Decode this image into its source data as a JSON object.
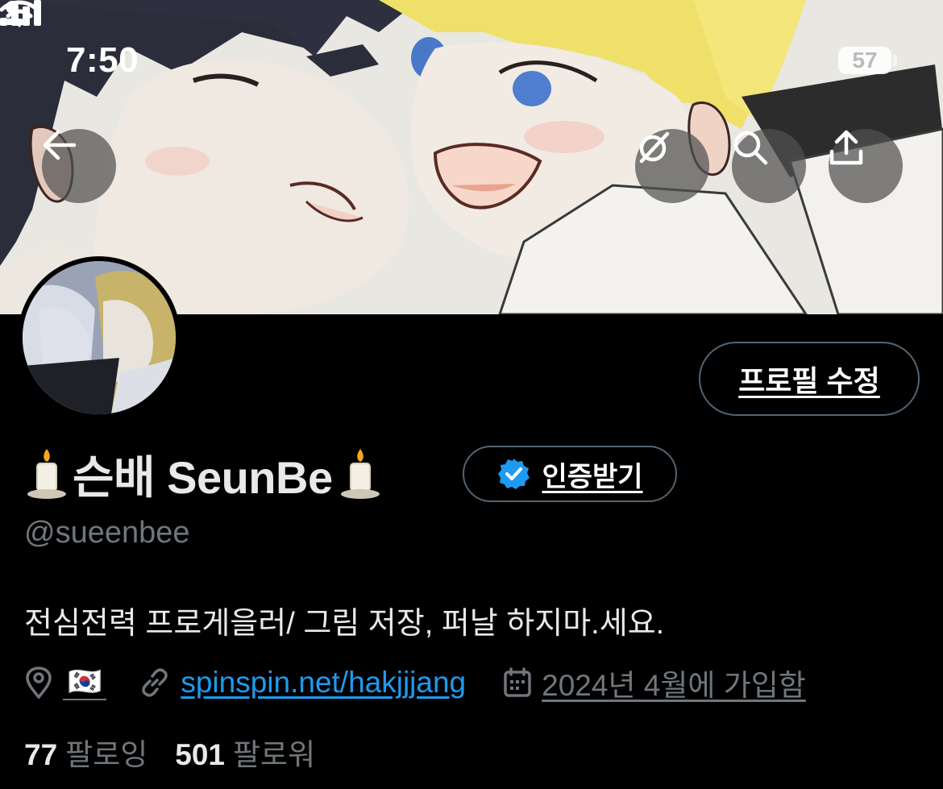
{
  "status_bar": {
    "time": "7:50",
    "battery": "57"
  },
  "profile": {
    "display_name": "슨배 SeunBe",
    "handle": "@sueenbee",
    "bio": "전심전력 프로게을러/ 그림 저장, 퍼날 하지마.세요.",
    "location_flag": "🇰🇷",
    "website": "spinspin.net/hakjjjang",
    "joined": "2024년 4월에 가입함",
    "edit_label": "프로필 수정",
    "verify_label": "인증받기"
  },
  "stats": {
    "following_count": "77",
    "following_label": "팔로잉",
    "followers_count": "501",
    "followers_label": "팔로워"
  },
  "icons": {
    "back": "arrow-left-icon",
    "grok": "grok-icon",
    "search": "search-icon",
    "share": "share-icon",
    "location": "location-pin-icon",
    "link": "link-icon",
    "calendar": "calendar-icon",
    "verified": "verified-badge-icon",
    "candle": "candle-icon"
  },
  "colors": {
    "accent": "#1d9bf0",
    "muted": "#71767b",
    "border": "#536471",
    "background": "#000000"
  }
}
